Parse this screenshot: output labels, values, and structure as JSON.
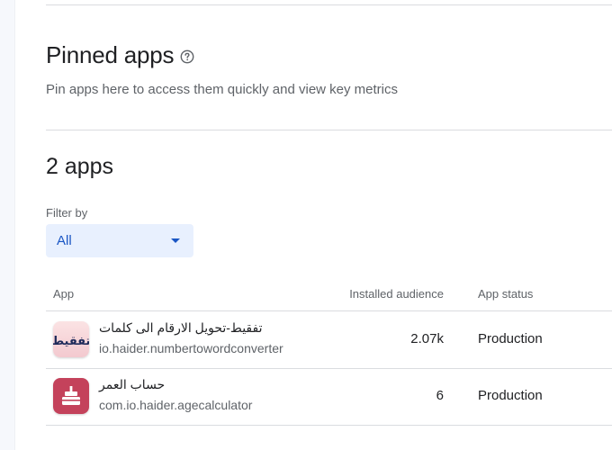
{
  "header": {
    "title": "Pinned apps",
    "subtitle": "Pin apps here to access them quickly and view key metrics",
    "help_icon": "help-circle-icon"
  },
  "apps_section": {
    "count_title": "2 apps",
    "filter": {
      "label": "Filter by",
      "selected": "All"
    }
  },
  "table": {
    "columns": {
      "app": "App",
      "audience": "Installed audience",
      "status": "App status"
    },
    "rows": [
      {
        "name": "تفقيط-تحويل الارقام الى كلمات",
        "package": "io.haider.numbertowordconverter",
        "audience": "2.07k",
        "status": "Production",
        "icon": "calligraphy-text-icon",
        "icon_text": "تفقيط"
      },
      {
        "name": "حساب العمر",
        "package": "com.io.haider.agecalculator",
        "audience": "6",
        "status": "Production",
        "icon": "birthday-cake-icon"
      }
    ]
  },
  "colors": {
    "accent": "#1a56c4",
    "filter_bg": "#e8f0fe",
    "divider": "#dadce0",
    "secondary_text": "#5f6368"
  }
}
